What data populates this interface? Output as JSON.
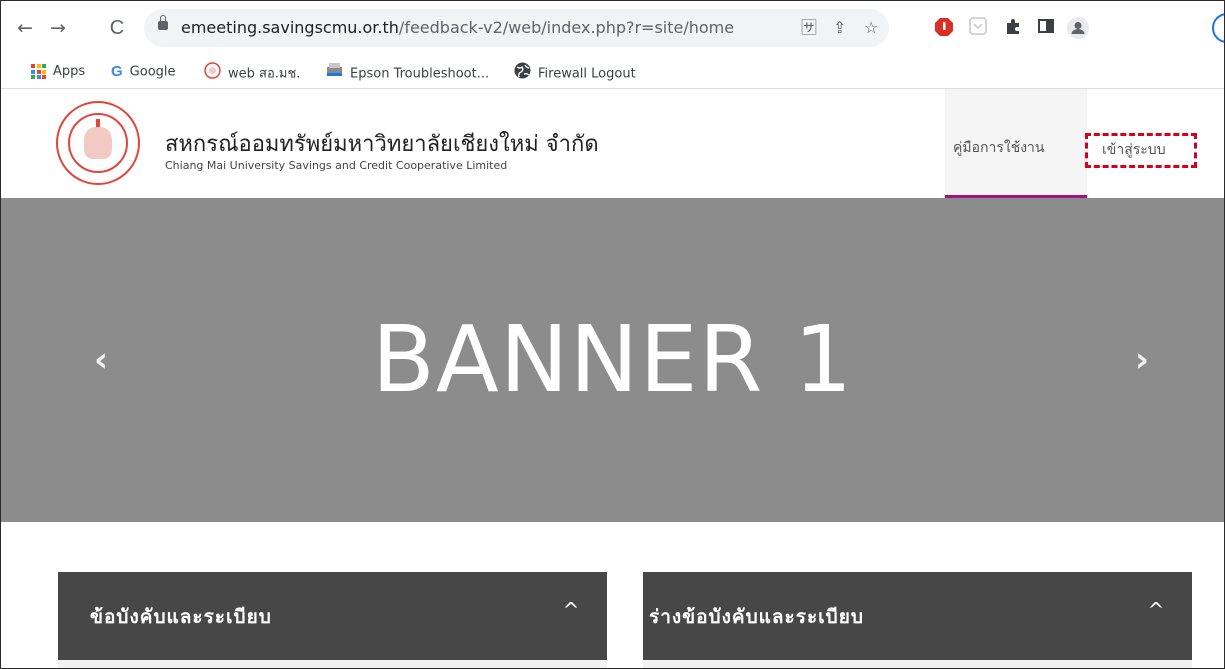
{
  "browser": {
    "url_host": "emeeting.savingscmu.or.th",
    "url_path": "/feedback-v2/web/index.php?r=site/home",
    "nav": {
      "back_icon": "←",
      "forward_icon": "→",
      "reload_icon": "C"
    },
    "omnibox_icons": {
      "translate": "🈂",
      "share": "⇪",
      "star": "☆"
    },
    "extensions": [
      "adblock-icon",
      "pocket-icon",
      "puzzle-icon",
      "sidepanel-icon",
      "profile-icon"
    ]
  },
  "bookmarks": [
    {
      "label": "Apps",
      "icon": "apps-grid-icon"
    },
    {
      "label": "Google",
      "icon": "google-icon"
    },
    {
      "label": "web สอ.มช.",
      "icon": "site-logo-icon"
    },
    {
      "label": "Epson Troubleshoot...",
      "icon": "epson-icon"
    },
    {
      "label": "Firewall Logout",
      "icon": "globe-icon"
    }
  ],
  "site": {
    "title_th": "สหกรณ์ออมทรัพย์มหาวิทยาลัยเชียงใหม่ จำกัด",
    "title_en": "Chiang Mai University Savings and Credit Cooperative Limited",
    "nav": {
      "manual": "คู่มือการใช้งาน",
      "login": "เข้าสู่ระบบ"
    },
    "accent_color": "#a0147d",
    "highlight_color": "#d6001c"
  },
  "banner": {
    "text": "BANNER 1",
    "prev_icon": "‹",
    "next_icon": "›"
  },
  "panels": [
    {
      "title": "ข้อบังคับและระเบียบ",
      "caret": "^"
    },
    {
      "title": "ร่างข้อบังคับและระเบียบ",
      "caret": "^"
    }
  ]
}
